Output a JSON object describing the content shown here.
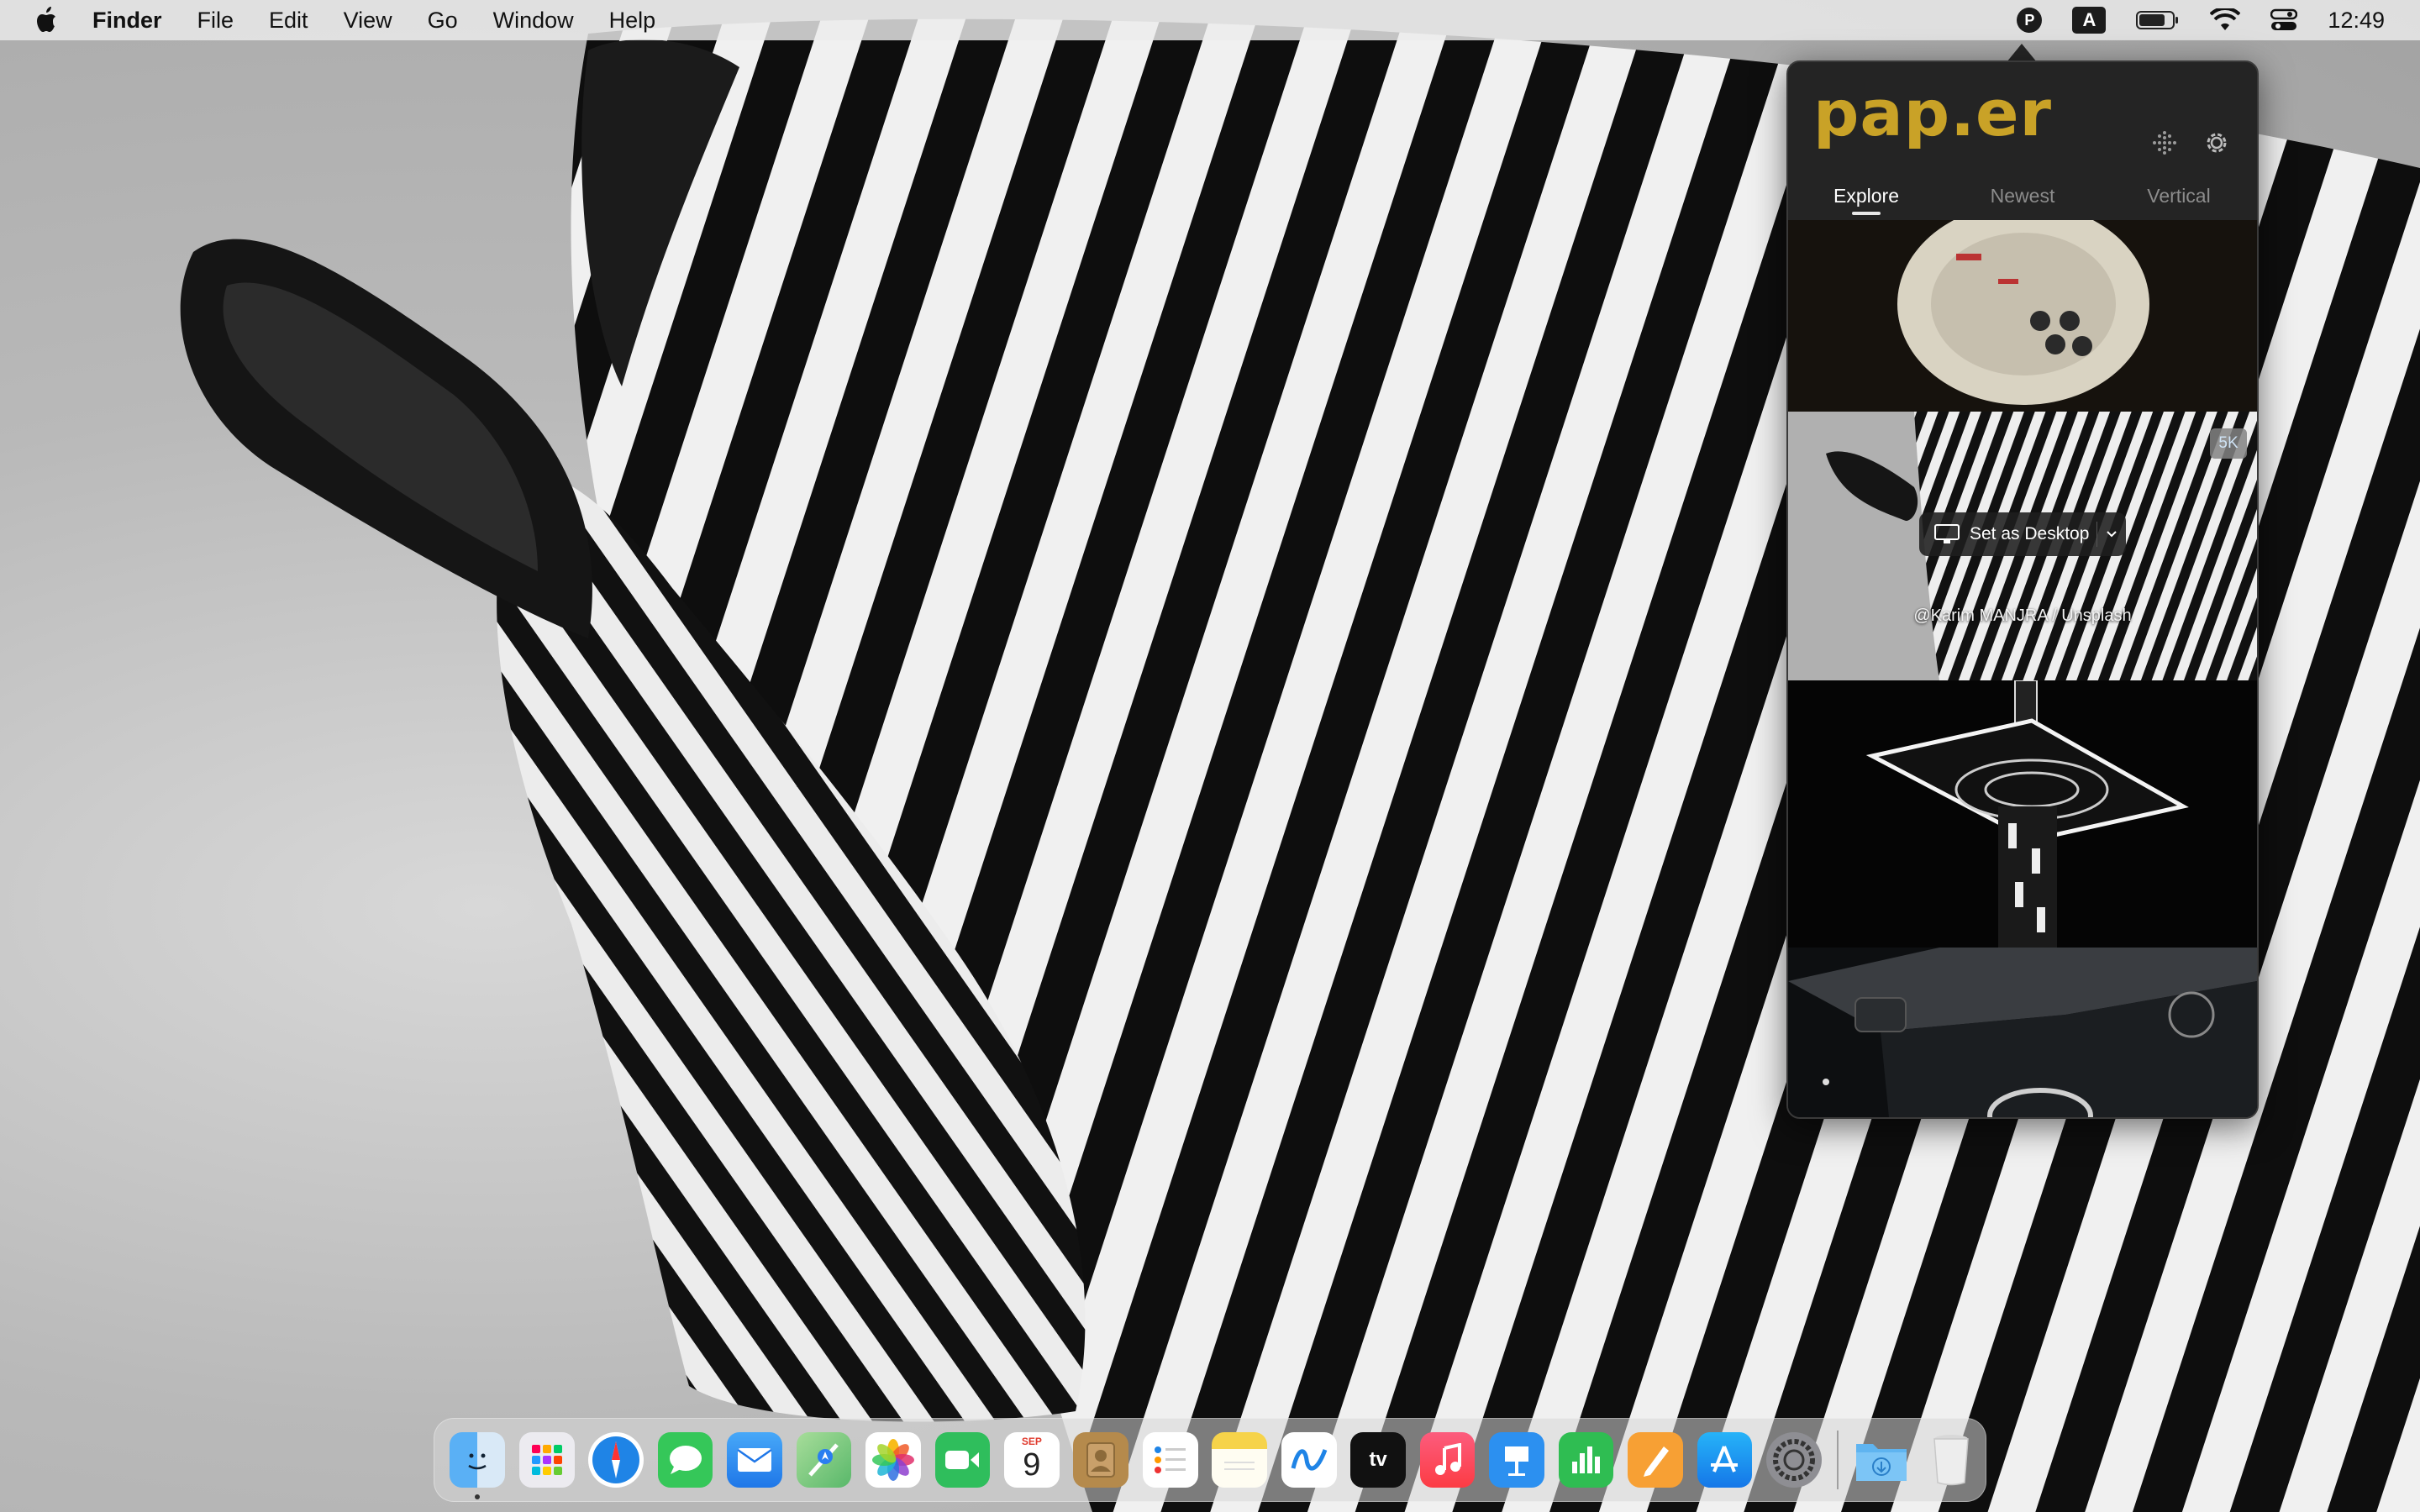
{
  "menubar": {
    "app_name": "Finder",
    "items": [
      "File",
      "Edit",
      "View",
      "Go",
      "Window",
      "Help"
    ],
    "status_icons": [
      "paper-app-icon",
      "input-source-icon",
      "battery-icon",
      "wifi-icon",
      "control-center-icon"
    ],
    "paper_badge": "P",
    "input_badge": "A",
    "clock": "12:49"
  },
  "popover": {
    "logo": "pap.er",
    "logo_color": "#c9a227",
    "tabs": [
      {
        "label": "Explore",
        "active": true
      },
      {
        "label": "Newest",
        "active": false
      },
      {
        "label": "Vertical",
        "active": false
      }
    ],
    "thumbnails": [
      {
        "subject": "millennium-falcon-model"
      },
      {
        "subject": "zebra",
        "resolution_badge": "5K",
        "set_desktop_label": "Set as Desktop",
        "credit": "@Karim MANJRA / Unsplash"
      },
      {
        "subject": "neon-platform"
      },
      {
        "subject": "car-hood"
      }
    ]
  },
  "dock": {
    "apps": [
      {
        "name": "Finder",
        "icon": "finder-icon",
        "color": "#2a8cf0",
        "running": true
      },
      {
        "name": "Launchpad",
        "icon": "launchpad-icon",
        "color": "#e9e9ef"
      },
      {
        "name": "Safari",
        "icon": "safari-icon",
        "color": "#1f84e6"
      },
      {
        "name": "Messages",
        "icon": "messages-icon",
        "color": "#35c759"
      },
      {
        "name": "Mail",
        "icon": "mail-icon",
        "color": "#2f8cf3"
      },
      {
        "name": "Maps",
        "icon": "maps-icon",
        "color": "#59b86a"
      },
      {
        "name": "Photos",
        "icon": "photos-icon",
        "color": "#ffffff"
      },
      {
        "name": "FaceTime",
        "icon": "facetime-icon",
        "color": "#2fbe5c"
      },
      {
        "name": "Calendar",
        "icon": "calendar-icon",
        "color": "#ffffff",
        "month": "SEP",
        "day": "9"
      },
      {
        "name": "Contacts",
        "icon": "contacts-icon",
        "color": "#b58a4c"
      },
      {
        "name": "Reminders",
        "icon": "reminders-icon",
        "color": "#ffffff"
      },
      {
        "name": "Notes",
        "icon": "notes-icon",
        "color": "#f6d34a"
      },
      {
        "name": "Freeform",
        "icon": "freeform-icon",
        "color": "#ffffff"
      },
      {
        "name": "TV",
        "icon": "tv-icon",
        "color": "#111111",
        "label": "tv"
      },
      {
        "name": "Music",
        "icon": "music-icon",
        "color": "#fc3c44"
      },
      {
        "name": "Keynote",
        "icon": "keynote-icon",
        "color": "#2c90f0"
      },
      {
        "name": "Numbers",
        "icon": "numbers-icon",
        "color": "#2fbd52"
      },
      {
        "name": "Pages",
        "icon": "pages-icon",
        "color": "#f7a034"
      },
      {
        "name": "App Store",
        "icon": "app-store-icon",
        "color": "#1c8ef5"
      },
      {
        "name": "System Settings",
        "icon": "settings-icon",
        "color": "#8e8e93"
      }
    ],
    "extras": [
      {
        "name": "Downloads",
        "icon": "downloads-folder-icon",
        "color": "#5fb4f0"
      },
      {
        "name": "Trash",
        "icon": "trash-icon",
        "color": "#e6e6e6"
      }
    ]
  }
}
